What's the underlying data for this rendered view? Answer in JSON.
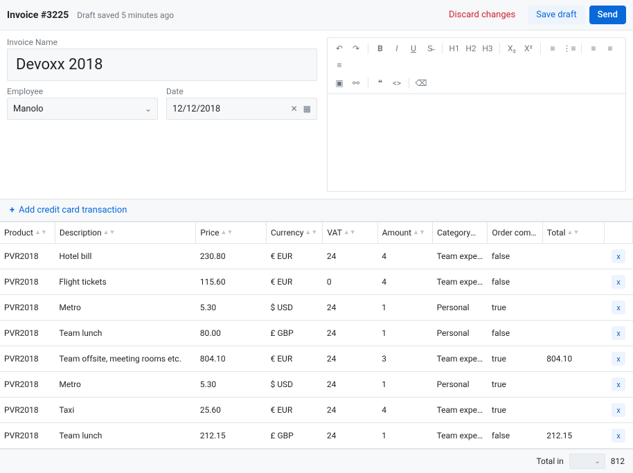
{
  "header": {
    "title": "Invoice #3225",
    "status": "Draft saved 5 minutes ago",
    "discard": "Discard changes",
    "save": "Save draft",
    "send": "Send"
  },
  "form": {
    "invoice_name_label": "Invoice Name",
    "invoice_name_value": "Devoxx 2018",
    "employee_label": "Employee",
    "employee_value": "Manolo",
    "date_label": "Date",
    "date_value": "12/12/2018"
  },
  "add_transaction": "Add credit card transaction",
  "columns": {
    "product": "Product",
    "description": "Description",
    "price": "Price",
    "currency": "Currency",
    "vat": "VAT",
    "amount": "Amount",
    "category": "Category",
    "order": "Order com…",
    "total": "Total"
  },
  "rows": [
    {
      "product": "PVR2018",
      "description": "Hotel bill",
      "price": "230.80",
      "currency": "€ EUR",
      "vat": "24",
      "amount": "4",
      "category": "Team expe…",
      "order": "false",
      "total": ""
    },
    {
      "product": "PVR2018",
      "description": "Flight tickets",
      "price": "115.60",
      "currency": "€ EUR",
      "vat": "0",
      "amount": "4",
      "category": "Team expe…",
      "order": "false",
      "total": ""
    },
    {
      "product": "PVR2018",
      "description": "Metro",
      "price": "5.30",
      "currency": "$ USD",
      "vat": "24",
      "amount": "1",
      "category": "Personal",
      "order": "true",
      "total": ""
    },
    {
      "product": "PVR2018",
      "description": "Team lunch",
      "price": "80.00",
      "currency": "£ GBP",
      "vat": "24",
      "amount": "1",
      "category": "Personal",
      "order": "false",
      "total": ""
    },
    {
      "product": "PVR2018",
      "description": "Team offsite, meeting rooms etc.",
      "price": "804.10",
      "currency": "€ EUR",
      "vat": "24",
      "amount": "3",
      "category": "Team expe…",
      "order": "true",
      "total": "804.10"
    },
    {
      "product": "PVR2018",
      "description": "Metro",
      "price": "5.30",
      "currency": "$ USD",
      "vat": "24",
      "amount": "1",
      "category": "Personal",
      "order": "true",
      "total": ""
    },
    {
      "product": "PVR2018",
      "description": "Taxi",
      "price": "25.60",
      "currency": "€ EUR",
      "vat": "24",
      "amount": "4",
      "category": "Team expe…",
      "order": "true",
      "total": ""
    },
    {
      "product": "PVR2018",
      "description": "Team lunch",
      "price": "212.15",
      "currency": "£ GBP",
      "vat": "24",
      "amount": "1",
      "category": "Team expe…",
      "order": "false",
      "total": "212.15"
    }
  ],
  "footer": {
    "label": "Total in",
    "value": "812"
  }
}
